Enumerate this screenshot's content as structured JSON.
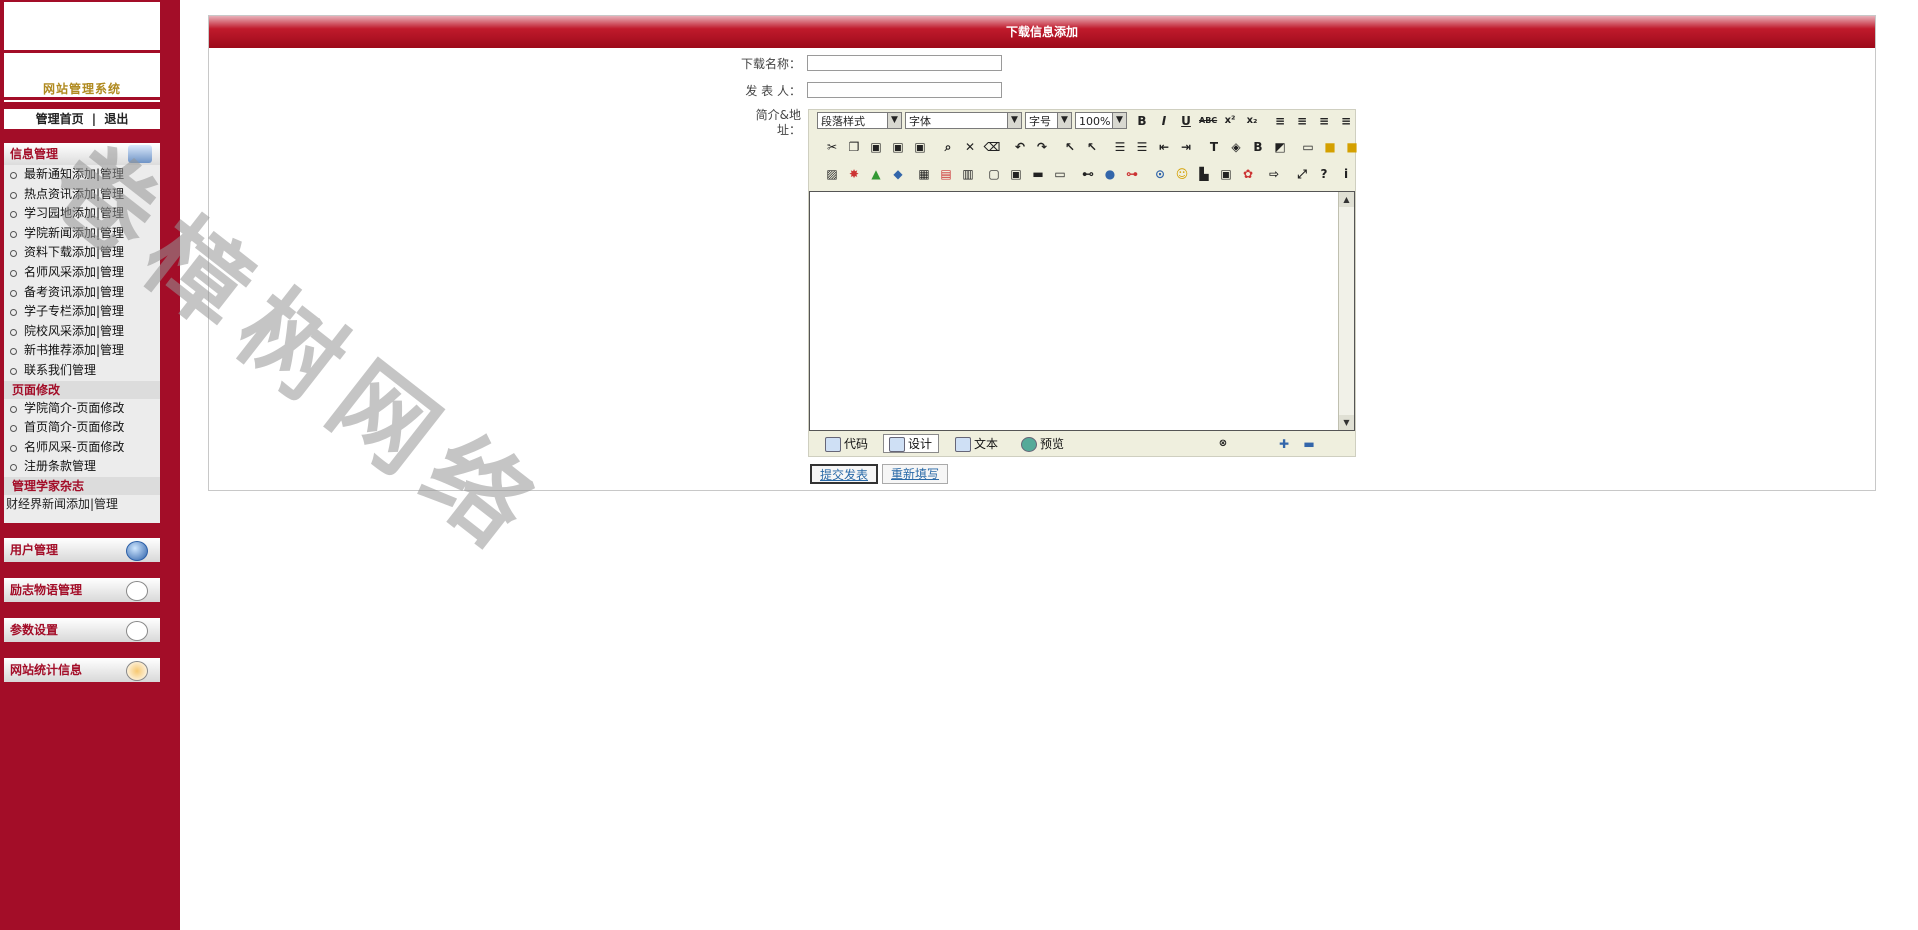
{
  "sidebar": {
    "logo_title": "网站管理系统",
    "top_links": [
      "管理首页",
      "|",
      "退出"
    ],
    "info_panel": {
      "title": "信息管理",
      "items": [
        "最新通知添加|管理",
        "热点资讯添加|管理",
        "学习园地添加|管理",
        "学院新闻添加|管理",
        "资料下载添加|管理",
        "名师风采添加|管理",
        "备考资讯添加|管理",
        "学子专栏添加|管理",
        "院校风采添加|管理",
        "新书推荐添加|管理",
        "联系我们管理"
      ],
      "page_edit_title": "页面修改",
      "page_edit_items": [
        "学院简介-页面修改",
        "首页简介-页面修改",
        "名师风采-页面修改",
        "注册条款管理"
      ],
      "magazine_title": "管理学家杂志",
      "magazine_item": "财经界新闻添加|管理"
    },
    "collapsed_panels": [
      "用户管理",
      "励志物语管理",
      "参数设置",
      "网站统计信息"
    ]
  },
  "main": {
    "title": "下载信息添加",
    "fields": {
      "name_label": "下载名称：",
      "name_value": "",
      "author_label": "发 表 人：",
      "author_value": "",
      "intro_label": "简介&地址："
    },
    "editor": {
      "paragraph_style": "段落样式",
      "font": "字体",
      "font_size": "字号",
      "zoom": "100%",
      "format_buttons": [
        "B",
        "I",
        "U",
        "ABC",
        "x²",
        "x₂"
      ],
      "modes": [
        "代码",
        "设计",
        "文本",
        "预览"
      ],
      "active_mode": "设计"
    },
    "buttons": {
      "submit": "提交发表",
      "reset": "重新填写"
    }
  },
  "watermark": "卷樟树网络"
}
